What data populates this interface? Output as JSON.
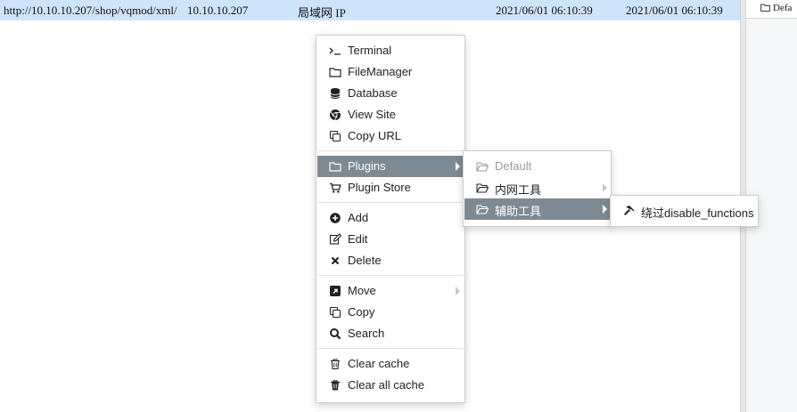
{
  "row": {
    "url": "http://10.10.10.207/shop/vqmod/xml/",
    "ip": "10.10.10.207",
    "location": "局域网 IP",
    "created": "2021/06/01 06:10:39",
    "updated": "2021/06/01 06:10:39"
  },
  "right_panel": {
    "item_label": "Defa"
  },
  "context_menu": {
    "terminal": "Terminal",
    "filemanager": "FileManager",
    "database": "Database",
    "view_site": "View Site",
    "copy_url": "Copy URL",
    "plugins": "Plugins",
    "plugin_store": "Plugin Store",
    "add": "Add",
    "edit": "Edit",
    "delete": "Delete",
    "move": "Move",
    "copy": "Copy",
    "search": "Search",
    "clear_cache": "Clear cache",
    "clear_all_cache": "Clear all cache"
  },
  "plugins_menu": {
    "default": "Default",
    "intranet_tools": "内网工具",
    "aux_tools": "辅助工具"
  },
  "aux_menu": {
    "bypass": "绕过disable_functions"
  },
  "colors": {
    "row_selected": "#cfe4fb",
    "menu_highlight": "#7e8a93"
  },
  "icons": [
    "terminal-icon",
    "folder-icon",
    "database-icon",
    "chrome-icon",
    "copy-icon",
    "cart-icon",
    "plus-circle-icon",
    "edit-icon",
    "close-icon",
    "move-icon",
    "search-icon",
    "trash-icon",
    "folder-open-icon",
    "hammer-icon"
  ]
}
